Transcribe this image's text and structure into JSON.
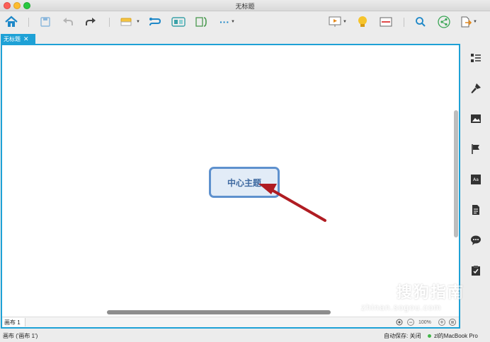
{
  "window": {
    "title": "无标题"
  },
  "toolbar": {
    "icons": [
      "home-icon",
      "save-icon",
      "undo-icon",
      "redo-icon",
      "insert-topic-icon",
      "relationship-icon",
      "boundary-icon",
      "summary-icon",
      "more-icon",
      "presentation-icon",
      "brainstorm-icon",
      "outline-icon",
      "search-icon",
      "share-icon",
      "export-icon"
    ],
    "more_label": "···",
    "accent": "#1ea1d6"
  },
  "tabs": [
    {
      "label": "无标题",
      "close": "✕"
    }
  ],
  "canvas": {
    "central_topic": "中心主题",
    "topic_fill": "#e2ecf7",
    "topic_border": "#5e91ce",
    "annotation_arrow_color": "#b01c22"
  },
  "sheetbar": {
    "sheet_tab": "画布 1",
    "zoom": "100%",
    "zoom_out": "−",
    "zoom_in": "+"
  },
  "rightpanel": {
    "icons": [
      "outline-view-icon",
      "format-brush-icon",
      "image-icon",
      "marker-flag-icon",
      "text-style-icon",
      "notes-icon",
      "comment-icon",
      "task-icon"
    ]
  },
  "statusbar": {
    "sheet": "画布 ('画布 1')",
    "autosave": "自动保存: 关闭",
    "user": "zl的MacBook Pro",
    "user_dot_color": "#43b649"
  },
  "watermark": {
    "text": "搜狗指南",
    "sub": "zhinan.sogou.com"
  }
}
